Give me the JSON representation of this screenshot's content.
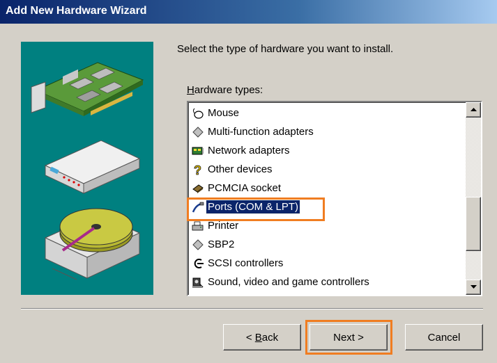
{
  "window": {
    "title": "Add New Hardware Wizard"
  },
  "instruction": "Select the type of hardware you want to install.",
  "hardware_types": {
    "label_accel": "H",
    "label_rest": "ardware types:",
    "items": [
      {
        "label": "Mouse",
        "icon": "mouse-icon"
      },
      {
        "label": "Multi-function adapters",
        "icon": "diamond-icon"
      },
      {
        "label": "Network adapters",
        "icon": "network-adapter-icon"
      },
      {
        "label": "Other devices",
        "icon": "question-mark-icon"
      },
      {
        "label": "PCMCIA socket",
        "icon": "pcmcia-icon"
      },
      {
        "label": "Ports (COM & LPT)",
        "icon": "port-cable-icon",
        "selected": true
      },
      {
        "label": "Printer",
        "icon": "printer-icon"
      },
      {
        "label": "SBP2",
        "icon": "diamond-icon"
      },
      {
        "label": "SCSI controllers",
        "icon": "scsi-icon"
      },
      {
        "label": "Sound, video and game controllers",
        "icon": "sound-icon"
      }
    ],
    "scroll_position": 0.62
  },
  "buttons": {
    "back_accel": "B",
    "back_rest": "ack",
    "next": "Next >",
    "cancel": "Cancel"
  },
  "colors": {
    "title_gradient_start": "#0a246a",
    "panel_bg": "#008080",
    "highlight": "#f07d21",
    "selection": "#0a246a"
  }
}
